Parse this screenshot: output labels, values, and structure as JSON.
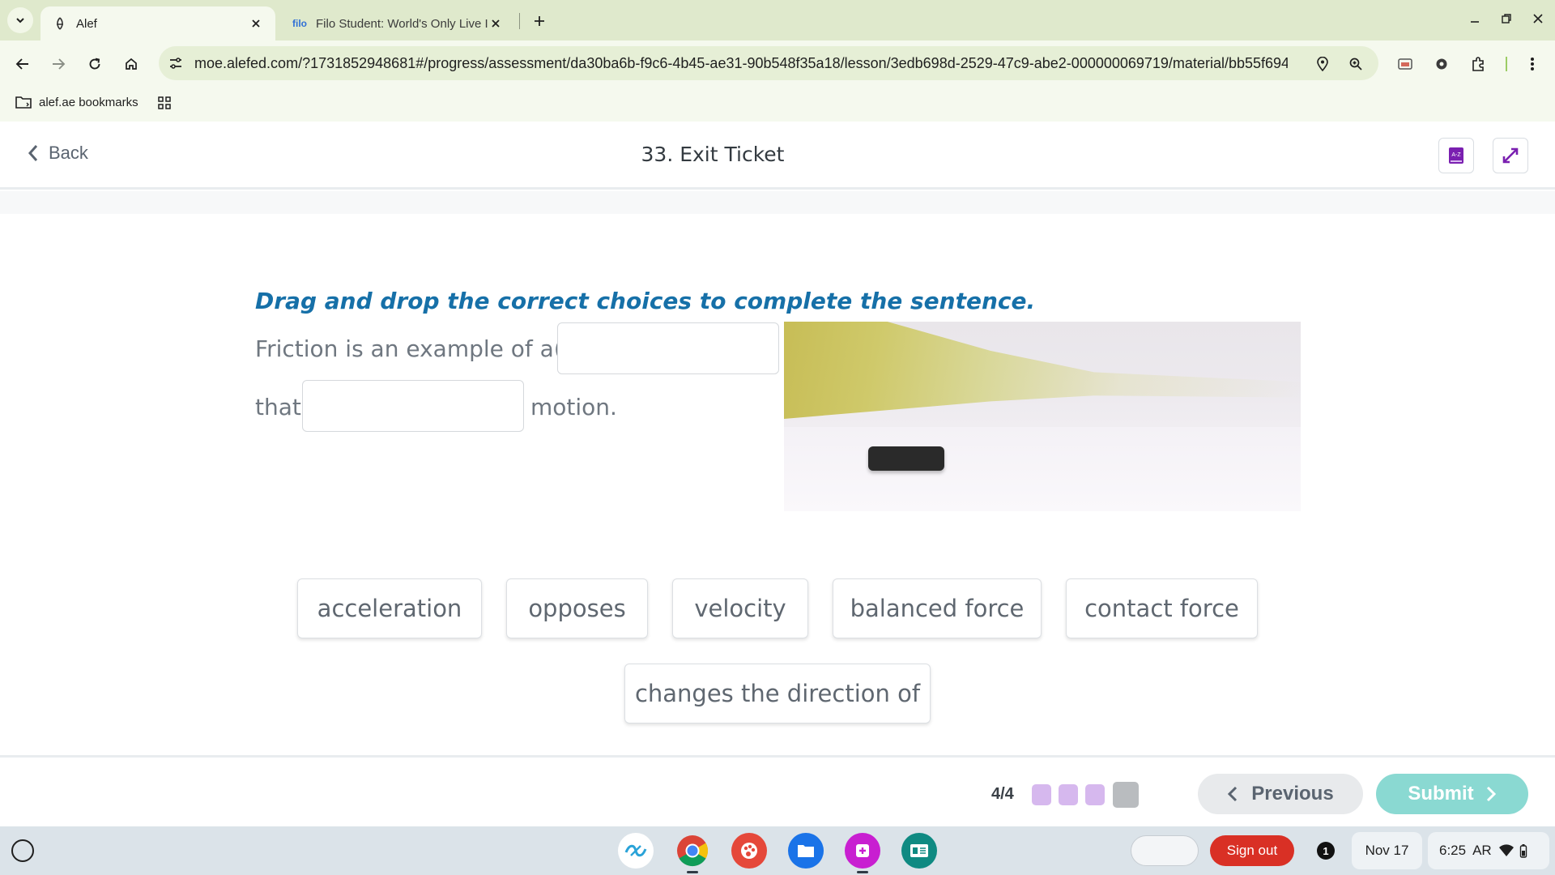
{
  "browser": {
    "tabs": [
      {
        "title": "Alef",
        "active": true
      },
      {
        "title": "Filo Student: World's Only Live I",
        "favicon_text": "filo",
        "active": false
      }
    ],
    "url": "moe.alefed.com/?1731852948681#/progress/assessment/da30ba6b-f9c6-4b45-ae31-90b548f35a18/lesson/3edb698d-2529-47c9-abe2-000000069719/material/bb55f694-...",
    "bookmarks": [
      {
        "label": "alef.ae bookmarks"
      }
    ]
  },
  "header": {
    "back_label": "Back",
    "title": "33. Exit Ticket",
    "glossary_icon_text": "A-Z"
  },
  "question": {
    "instruction": "Drag and drop the correct choices to complete the sentence.",
    "line1_text": "Friction is an example of a(n)",
    "line2_prefix": "that",
    "line2_suffix": "motion."
  },
  "choices": [
    {
      "label": "acceleration"
    },
    {
      "label": "opposes"
    },
    {
      "label": "velocity"
    },
    {
      "label": "balanced force"
    },
    {
      "label": "contact force"
    },
    {
      "label": "changes the direction of"
    }
  ],
  "footer": {
    "progress_label": "4/4",
    "progress_colors": [
      "#d6b8ee",
      "#d6b8ee",
      "#d6b8ee",
      "#b9bcbf"
    ],
    "previous_label": "Previous",
    "submit_label": "Submit"
  },
  "shelf": {
    "signout_label": "Sign out",
    "notification_count": "1",
    "date": "Nov 17",
    "time": "6:25",
    "input_method": "AR"
  },
  "colors": {
    "accent_blue": "#1670a8",
    "submit_teal": "#8ad9d2",
    "signout_red": "#d93025"
  }
}
